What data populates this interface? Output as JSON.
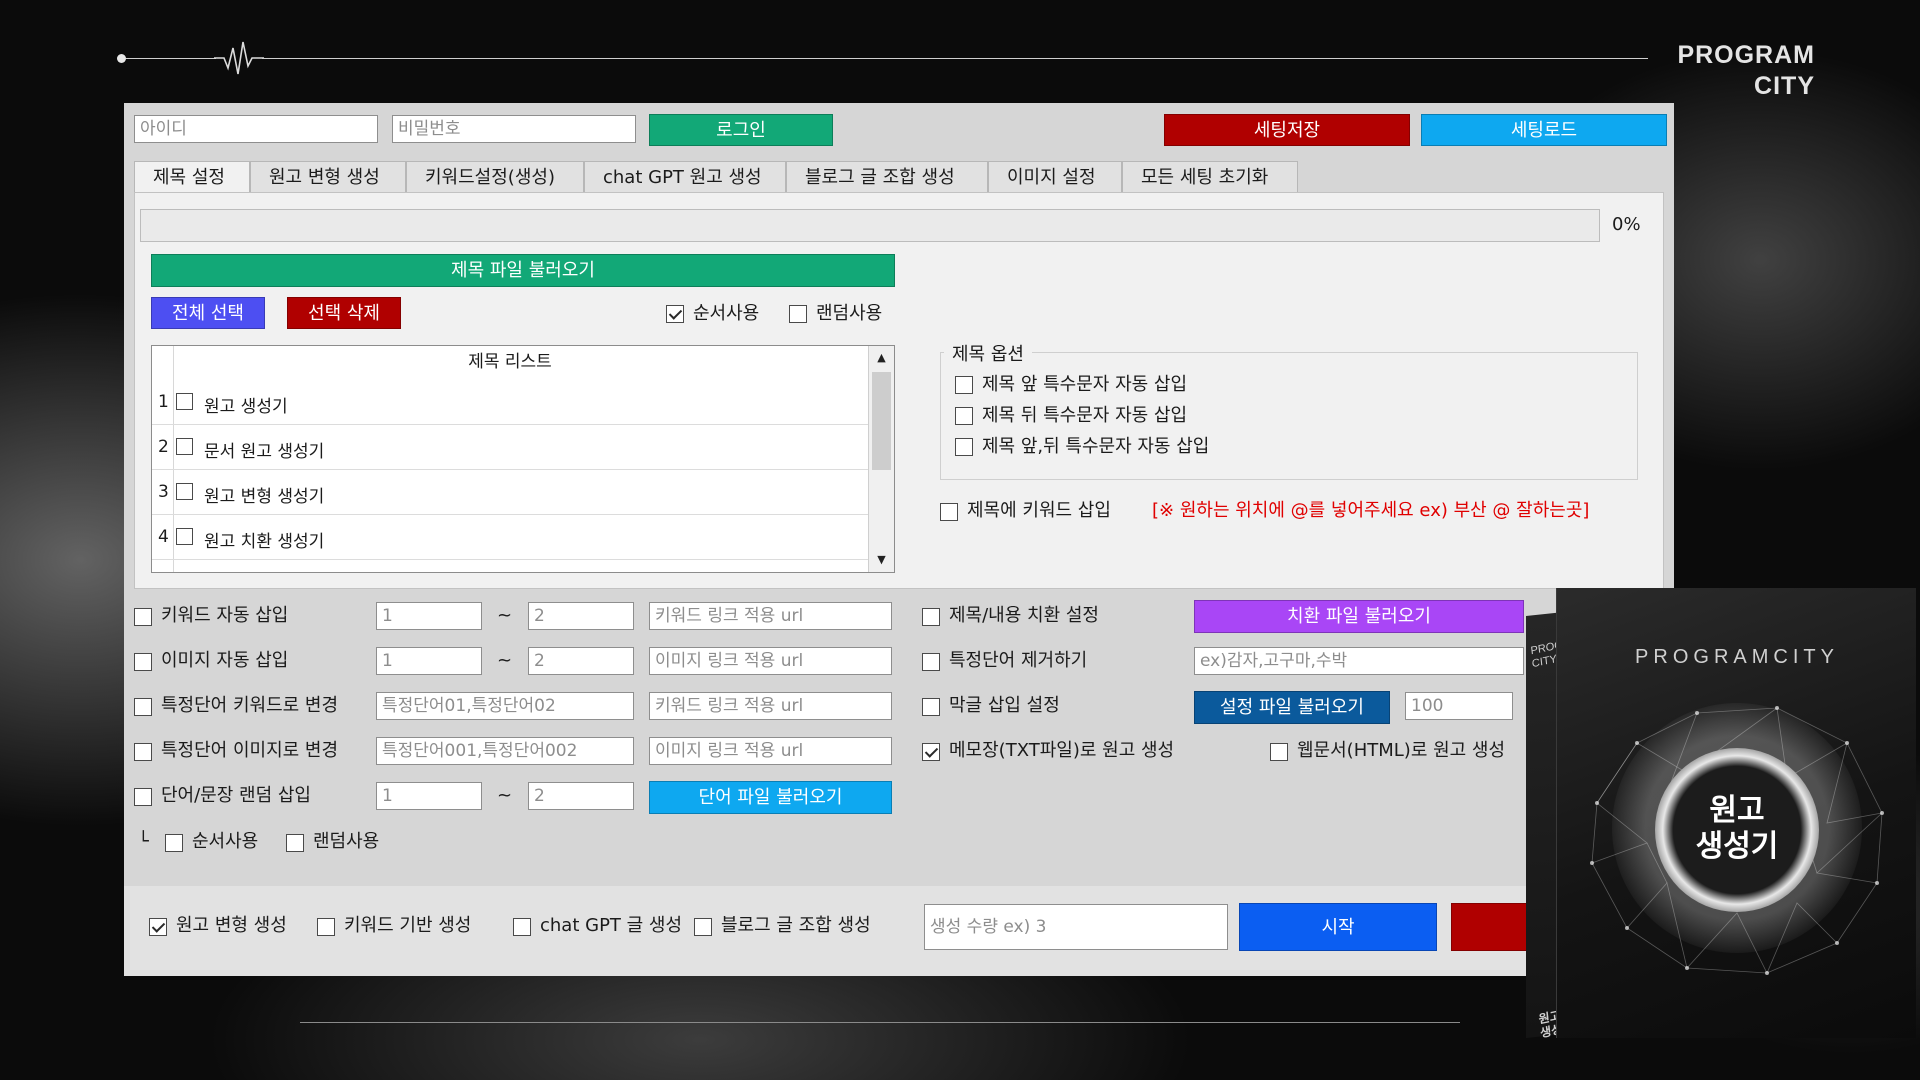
{
  "brand": {
    "line1": "PROGRAM",
    "line2": "CITY"
  },
  "login": {
    "id_placeholder": "아이디",
    "pw_placeholder": "비밀번호",
    "login_label": "로그인",
    "save_settings_label": "세팅저장",
    "load_settings_label": "세팅로드"
  },
  "tabs": [
    {
      "label": "제목 설정",
      "active": true
    },
    {
      "label": "원고 변형 생성"
    },
    {
      "label": "키워드설정(생성)"
    },
    {
      "label": "chat GPT 원고 생성"
    },
    {
      "label": "블로그 글 조합 생성"
    },
    {
      "label": "이미지 설정"
    },
    {
      "label": "모든 세팅 초기화"
    }
  ],
  "title_tab": {
    "progress": {
      "value": 0,
      "label": "0%"
    },
    "load_file_label": "제목 파일 불러오기",
    "select_all_label": "전체 선택",
    "delete_selected_label": "선택 삭제",
    "order_use_label": "순서사용",
    "order_use_checked": true,
    "random_use_label": "랜덤사용",
    "random_use_checked": false,
    "list": {
      "header": "제목 리스트",
      "rows": [
        {
          "num": "1",
          "text": "원고 생성기"
        },
        {
          "num": "2",
          "text": "문서 원고 생성기"
        },
        {
          "num": "3",
          "text": "원고 변형 생성기"
        },
        {
          "num": "4",
          "text": "원고 치환 생성기"
        }
      ]
    },
    "options": {
      "title": "제목 옵션",
      "items": [
        "제목 앞 특수문자 자동 삽입",
        "제목 뒤 특수문자 자동 삽입",
        "제목 앞,뒤 특수문자 자동 삽입"
      ]
    },
    "keyword_insert_label": "제목에 키워드 삽입",
    "keyword_insert_hint": "[※ 원하는 위치에 @를 넣어주세요 ex) 부산 @ 잘하는곳]"
  },
  "settings": {
    "rows": [
      {
        "label": "키워드 자동 삽입",
        "from": "1",
        "sep": "~",
        "to": "2",
        "url_placeholder": "키워드 링크 적용 url"
      },
      {
        "label": "이미지 자동 삽입",
        "from": "1",
        "sep": "~",
        "to": "2",
        "url_placeholder": "이미지 링크 적용 url"
      },
      {
        "label": "특정단어 키워드로 변경",
        "words_placeholder": "특정단어01,특정단어02",
        "url_placeholder": "키워드 링크 적용 url"
      },
      {
        "label": "특정단어 이미지로 변경",
        "words_placeholder": "특정단어001,특정단어002",
        "url_placeholder": "이미지 링크 적용 url"
      },
      {
        "label": "단어/문장 랜덤 삽입",
        "from": "1",
        "sep": "~",
        "to": "2",
        "button_label": "단어 파일 불러오기"
      }
    ],
    "sub_prefix": "└",
    "sub_order_label": "순서사용",
    "sub_random_label": "랜덤사용",
    "right": {
      "replace_label": "제목/내용 치환 설정",
      "replace_button": "치환 파일 불러오기",
      "remove_label": "특정단어 제거하기",
      "remove_placeholder": "ex)감자,고구마,수박",
      "slang_label": "막글 삽입 설정",
      "slang_button": "설정 파일 불러오기",
      "slang_value": "100",
      "txt_label": "메모장(TXT파일)로 원고 생성",
      "txt_checked": true,
      "html_label": "웹문서(HTML)로 원고 생성",
      "html_checked": false
    }
  },
  "bottom": {
    "mode1_label": "원고 변형 생성",
    "mode1_checked": true,
    "mode2_label": "키워드 기반 생성",
    "mode3_label": "chat GPT 글 생성",
    "mode4_label": "블로그 글 조합 생성",
    "count_placeholder": "생성 수량 ex) 3",
    "start_label": "시작"
  },
  "product_box": {
    "brand": "PROGRAMCITY",
    "title_line1": "원고",
    "title_line2": "생성기",
    "side_brand_line1": "PROGRAM",
    "side_brand_line2": "CITY",
    "side_title_line1": "원고",
    "side_title_line2": "생성기"
  }
}
